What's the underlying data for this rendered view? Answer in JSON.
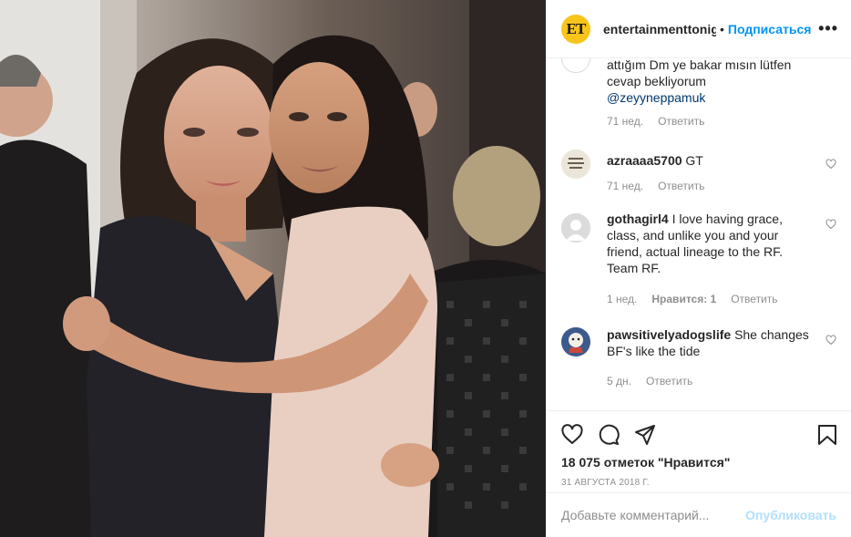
{
  "photo": {
    "alt": "Photo"
  },
  "header": {
    "avatar_text": "ET",
    "username": "entertainmenttonight",
    "separator": "•",
    "follow_label": "Подписаться",
    "more_label": "•••"
  },
  "comments": [
    {
      "user": "",
      "text": "attığım Dm ye bakar mısın lütfen cevap bekliyorum",
      "mention": "@zeyyneppamuk",
      "time": "71 нед.",
      "likes_label": "",
      "reply_label": "Ответить"
    },
    {
      "user": "azraaaa5700",
      "text": "GT",
      "time": "71 нед.",
      "likes_label": "",
      "reply_label": "Ответить"
    },
    {
      "user": "gothagirl4",
      "text": "I love having grace, class, and unlike you and your friend, actual lineage to the RF. Team RF.",
      "time": "1 нед.",
      "likes_label": "Нравится: 1",
      "reply_label": "Ответить"
    },
    {
      "user": "pawsitivelyadogslife",
      "text": "She changes BF's like the tide",
      "time": "5 дн.",
      "likes_label": "",
      "reply_label": "Ответить"
    }
  ],
  "actions": {
    "like_icon": "heart-outline",
    "comment_icon": "speech-bubble",
    "share_icon": "paper-plane",
    "save_icon": "bookmark"
  },
  "likes_text": "18 075 отметок \"Нравится\"",
  "date_text": "31 АВГУСТА 2018 Г.",
  "add_comment": {
    "placeholder": "Добавьте комментарий...",
    "post_label": "Опубликовать"
  },
  "colors": {
    "accent": "#0095f6",
    "post_disabled": "#b2dffc",
    "secondary_text": "#8e8e8e",
    "border": "#efefef",
    "brand_yellow": "#f7c51a"
  }
}
